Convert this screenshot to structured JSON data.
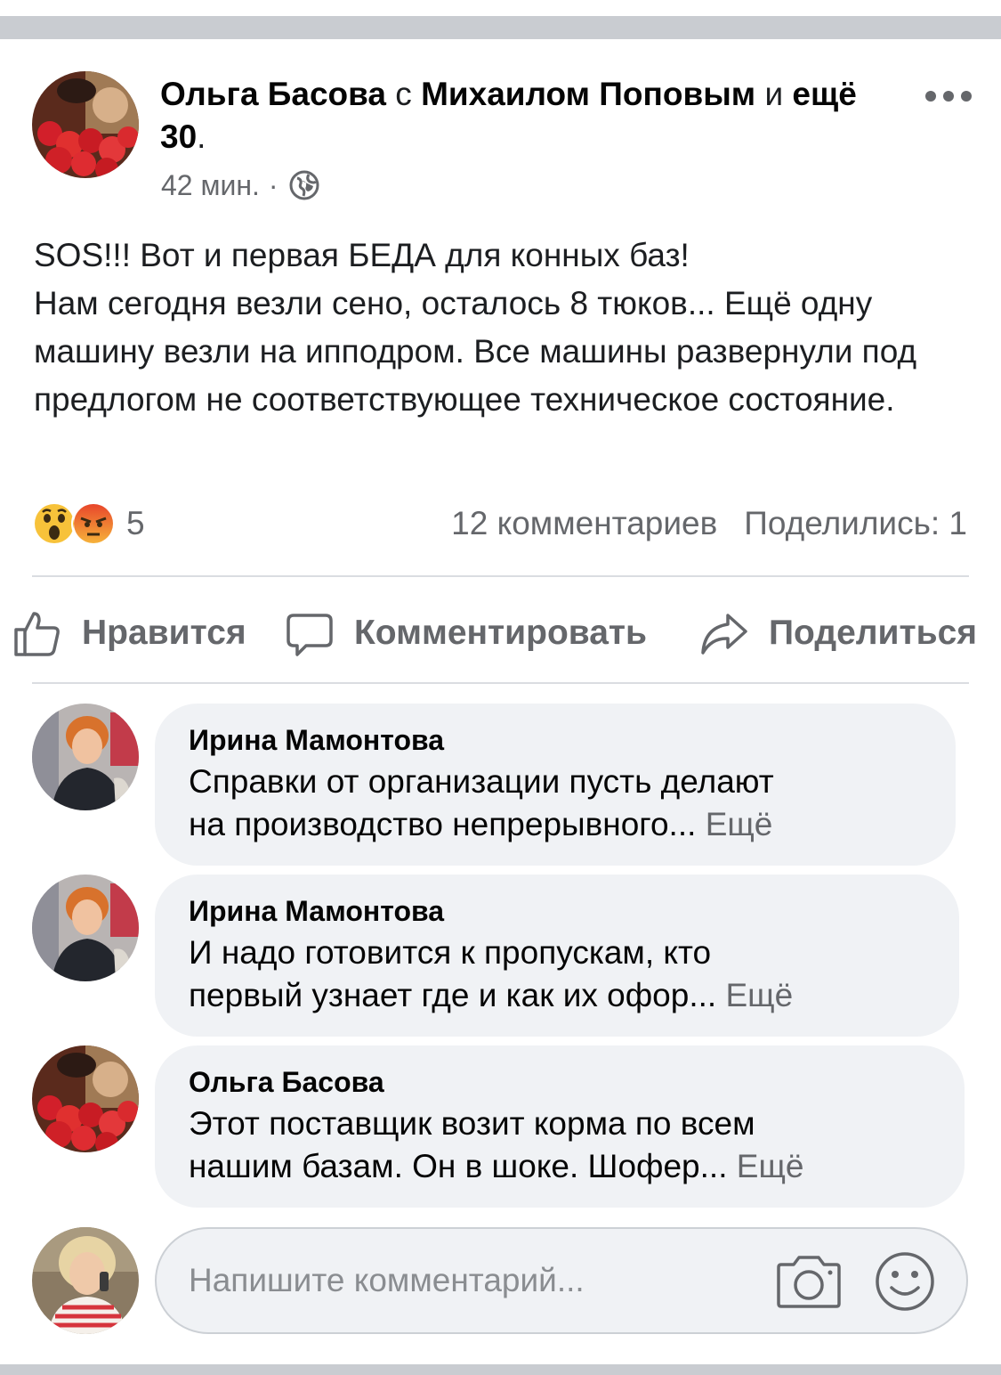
{
  "post": {
    "author": "Ольга Басова",
    "with_word": "с",
    "tagged": "Михаилом Поповым",
    "and_word": "и",
    "others": "ещё 30",
    "period": ".",
    "time": "42 мин.",
    "separator": "·",
    "text": "SOS!!! Вот и первая БЕДА для конных баз!\nНам сегодня везли сено, осталось 8 тюков... Ещё одну машину везли на ипподром. Все машины развернули под предлогом не соответствующее техническое состояние.",
    "reaction_count": "5",
    "comments_count": "12 комментариев",
    "shares": "Поделились: 1",
    "reaction_icons": [
      "wow-emoji",
      "angry-emoji"
    ]
  },
  "actions": {
    "like": "Нравится",
    "comment": "Комментировать",
    "share": "Поделиться"
  },
  "comments": [
    {
      "author": "Ирина Мамонтова",
      "line1": "Справки от организации пусть делают",
      "line2": "на производство непрерывного...",
      "more": "Ещё"
    },
    {
      "author": "Ирина Мамонтова",
      "line1": "И надо готовится к пропускам, кто",
      "line2": "первый узнает где и как их офор...",
      "more": "Ещё"
    },
    {
      "author": "Ольга Басова",
      "line1": "Этот поставщик возит корма по всем",
      "line2": "нашим базам. Он в шоке. Шофер...",
      "more": "Ещё"
    }
  ],
  "composer": {
    "placeholder": "Напишите комментарий..."
  },
  "colors": {
    "secondary_text": "#65676b",
    "bubble_bg": "#f0f2f5",
    "divider": "#dadde1",
    "band": "#c9ccd1"
  }
}
